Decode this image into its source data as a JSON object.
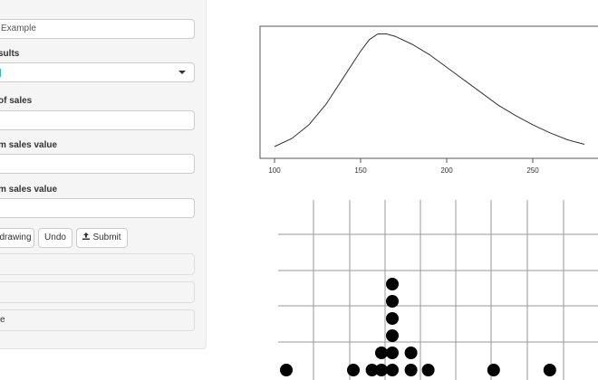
{
  "sidebar": {
    "title_input": {
      "value": "Example"
    },
    "results_label": "sults",
    "sales_count_label": "of sales",
    "sales_count_input": {
      "value": ""
    },
    "min_value_label": "m sales value",
    "min_value_input": {
      "value": ""
    },
    "max_value_label": "m sales value",
    "max_value_input": {
      "value": ""
    },
    "buttons": {
      "reset": "drawing",
      "undo": "Undo",
      "submit": "Submit"
    },
    "outputs": [
      "",
      "",
      "e"
    ]
  },
  "chart_data": [
    {
      "type": "line",
      "x_ticks": [
        100,
        150,
        200,
        250
      ],
      "xlim": [
        92,
        300
      ],
      "ylim": [
        0,
        1
      ],
      "x": [
        100,
        110,
        120,
        130,
        140,
        150,
        155,
        160,
        165,
        170,
        180,
        190,
        200,
        210,
        220,
        230,
        240,
        250,
        260,
        270,
        280
      ],
      "y": [
        0.0,
        0.07,
        0.19,
        0.37,
        0.6,
        0.83,
        0.93,
        0.98,
        0.98,
        0.96,
        0.89,
        0.8,
        0.69,
        0.58,
        0.47,
        0.36,
        0.27,
        0.19,
        0.12,
        0.06,
        0.02
      ],
      "grid": false
    },
    {
      "type": "scatter",
      "grid": true,
      "x": [
        114,
        157,
        169,
        175,
        175,
        182,
        182,
        182,
        182,
        182,
        182,
        194,
        194,
        205,
        247,
        283
      ],
      "y": [
        0,
        0,
        0,
        0,
        1,
        0,
        1,
        2,
        3,
        4,
        5,
        0,
        1,
        0,
        0,
        0
      ]
    }
  ]
}
